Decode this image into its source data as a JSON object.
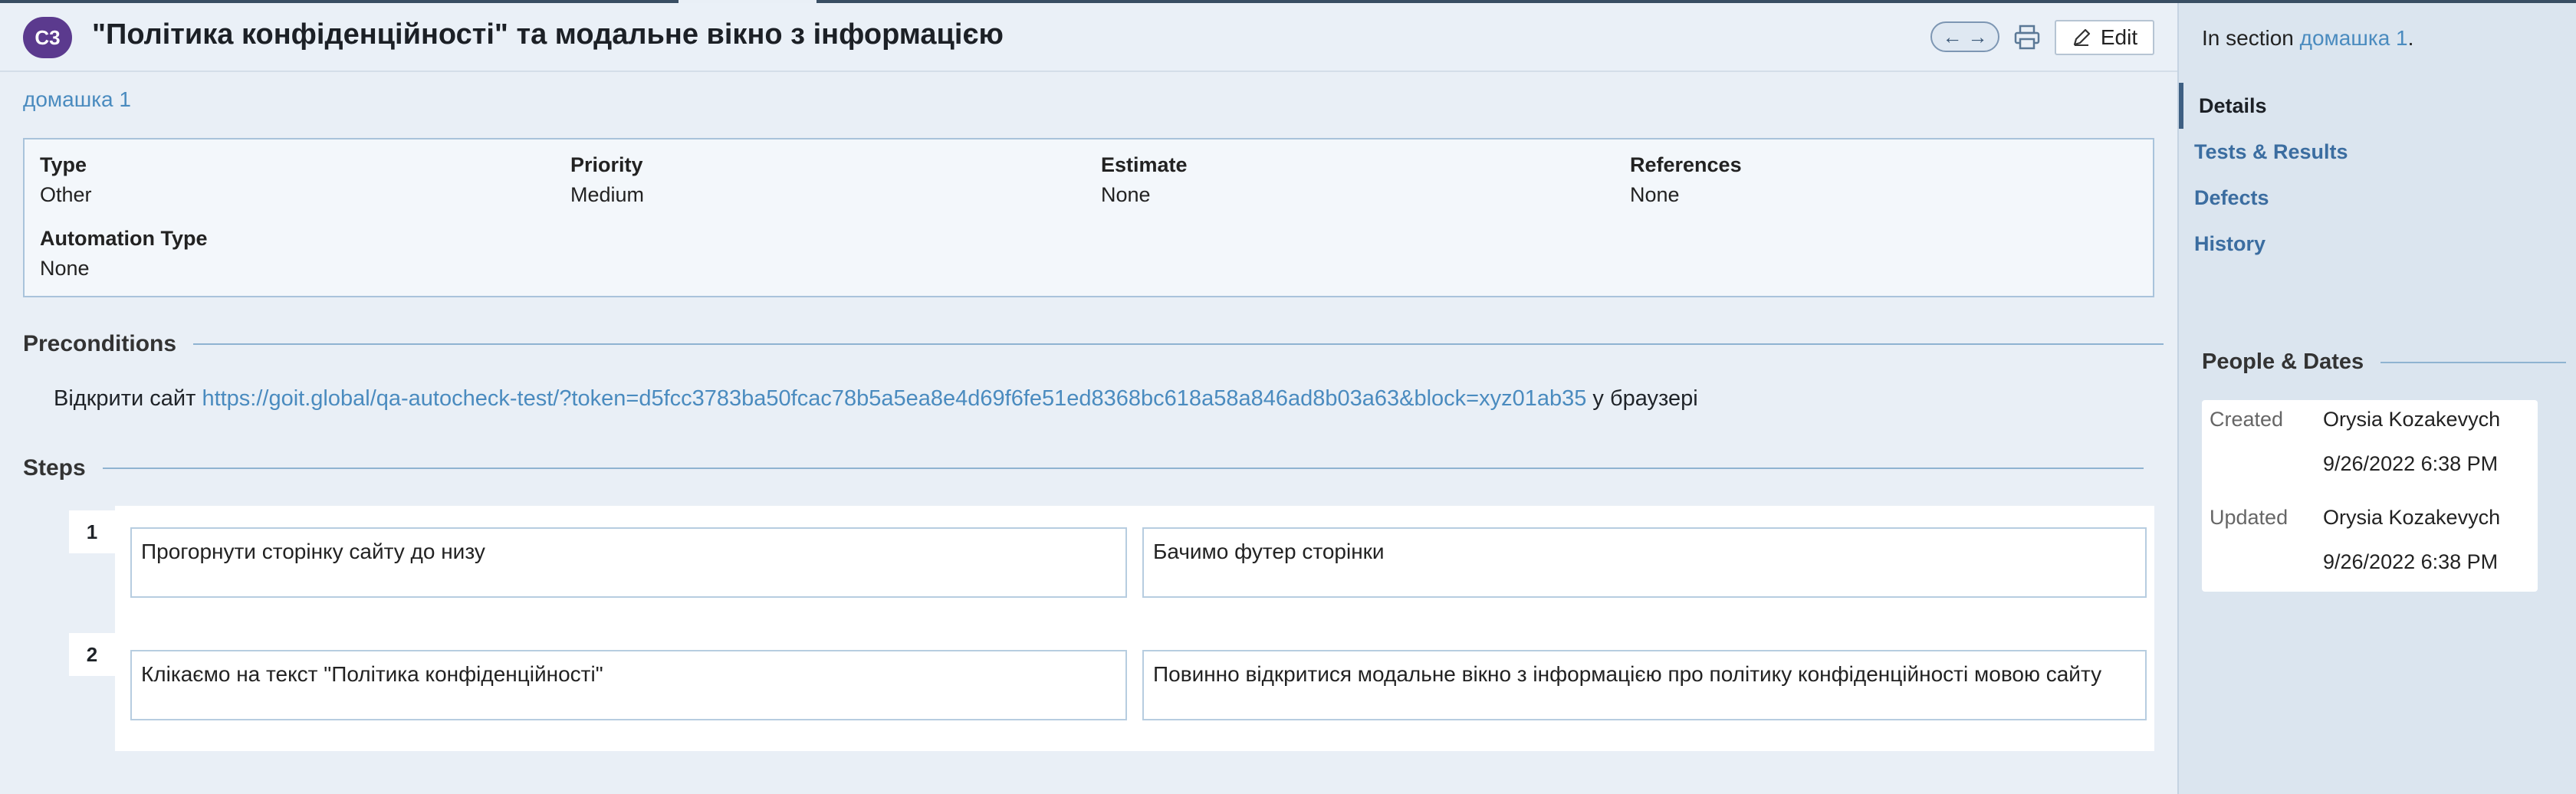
{
  "case_id": "C3",
  "title": "\"Політика конфіденційності\" та модальне вікно з інформацією",
  "toolbar": {
    "prev_icon": "←",
    "next_icon": "→",
    "print_icon": "printer-icon",
    "edit_label": "Edit"
  },
  "section_link": "домашка 1",
  "properties": {
    "type_label": "Type",
    "type_value": "Other",
    "priority_label": "Priority",
    "priority_value": "Medium",
    "estimate_label": "Estimate",
    "estimate_value": "None",
    "references_label": "References",
    "references_value": "None",
    "automation_label": "Automation Type",
    "automation_value": "None"
  },
  "preconditions": {
    "heading": "Preconditions",
    "text_before": "Відкрити сайт ",
    "url": "https://goit.global/qa-autocheck-test/?token=d5fcc3783ba50fcac78b5a5ea8e4d69f6fe51ed8368bc618a58a846ad8b03a63&block=xyz01ab35",
    "text_after": " у браузері"
  },
  "steps": {
    "heading": "Steps",
    "items": [
      {
        "num": "1",
        "action": "Прогорнути сторінку сайту до низу",
        "expected": "Бачимо футер сторінки"
      },
      {
        "num": "2",
        "action": "Клікаємо на текст \"Політика конфіденційності\"",
        "expected": "Повинно відкритися модальне вікно з інформацією про політику конфіденційності мовою сайту"
      }
    ]
  },
  "sidebar": {
    "in_section_prefix": "In section ",
    "in_section_link": "домашка 1",
    "in_section_suffix": ".",
    "nav": [
      "Details",
      "Tests & Results",
      "Defects",
      "History"
    ],
    "people_heading": "People & Dates",
    "created_label": "Created",
    "created_by": "Orysia Kozakevych",
    "created_at": "9/26/2022 6:38 PM",
    "updated_label": "Updated",
    "updated_by": "Orysia Kozakevych",
    "updated_at": "9/26/2022 6:38 PM"
  },
  "colors": {
    "badge": "#5b3a8e",
    "link": "#4a8bbf",
    "accent_bar": "#394e63"
  }
}
